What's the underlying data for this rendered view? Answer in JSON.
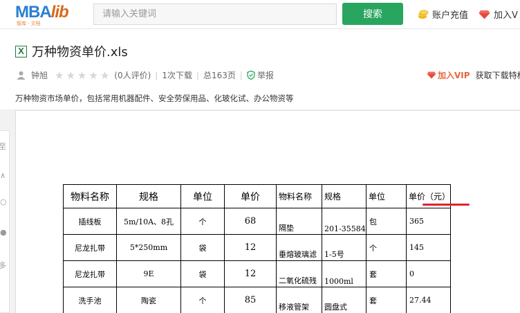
{
  "header": {
    "logo_text": "MBA",
    "logo_text_2": "lib",
    "logo_sub": "智库 · 文档",
    "search_placeholder": "请输入关键词",
    "search_button": "搜索",
    "recharge": "账户充值",
    "join_vip": "加入V"
  },
  "doc": {
    "title": "万种物资单价.xls",
    "author": "钟旭",
    "ratings": "(0人评价)",
    "downloads": "1次下载",
    "pages": "总163页",
    "report": "举报",
    "join_vip": "加入VIP",
    "get_download": "获取下载特权",
    "description": "万种物资市场单价，包括常用机器配件、安全劳保用品、化玻化试、办公物资等"
  },
  "side": {
    "t1": "至",
    "t2": "多"
  },
  "sheet": {
    "headers": [
      "物料名称",
      "规格",
      "单位",
      "单价",
      "物料名称",
      "规格",
      "单位",
      "单价（元）"
    ],
    "rows": [
      [
        "插线板",
        "5m/10A、8孔",
        "个",
        "68",
        "隔垫",
        "201-35584",
        "包",
        "365"
      ],
      [
        "尼龙扎带",
        "5*250mm",
        "袋",
        "12",
        "垂熔玻璃滤",
        "1-5号",
        "个",
        "145"
      ],
      [
        "尼龙扎带",
        "9E",
        "袋",
        "12",
        "二氧化硫残",
        "1000ml",
        "套",
        "0"
      ],
      [
        "洗手池",
        "陶瓷",
        "个",
        "85",
        "移液管架",
        "圆盘式",
        "套",
        "27.44"
      ]
    ]
  },
  "colors": {
    "accent_green": "#28a55f",
    "vip_orange": "#e8663d",
    "underline_red": "#e2202a"
  }
}
